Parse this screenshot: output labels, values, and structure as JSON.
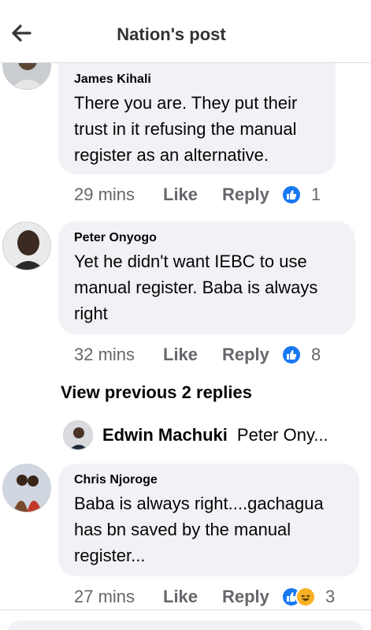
{
  "header": {
    "title": "Nation's post"
  },
  "comments": [
    {
      "author": "James Kihali",
      "text": "There you are. They put their trust in it refusing the manual register as an alternative.",
      "time": "29 mins",
      "like_label": "Like",
      "reply_label": "Reply",
      "reaction_count": "1"
    },
    {
      "author": "Peter Onyogo",
      "text": "Yet he didn't want IEBC to use manual register. Baba is always right",
      "time": "32 mins",
      "like_label": "Like",
      "reply_label": "Reply",
      "reaction_count": "8"
    },
    {
      "author": "Chris Njoroge",
      "text": "Baba is always right....gachagua has bn saved by the manual register...",
      "time": "27 mins",
      "like_label": "Like",
      "reply_label": "Reply",
      "reaction_count": "3"
    }
  ],
  "view_previous": "View previous 2 replies",
  "reply_preview": {
    "author": "Edwin Machuki",
    "snippet": "Peter Ony..."
  },
  "colors": {
    "accent": "#1877f2",
    "bubble": "#f0f2f5",
    "muted": "#65676b"
  },
  "icons": [
    "back-arrow-icon",
    "like-reaction-icon",
    "haha-reaction-icon"
  ]
}
